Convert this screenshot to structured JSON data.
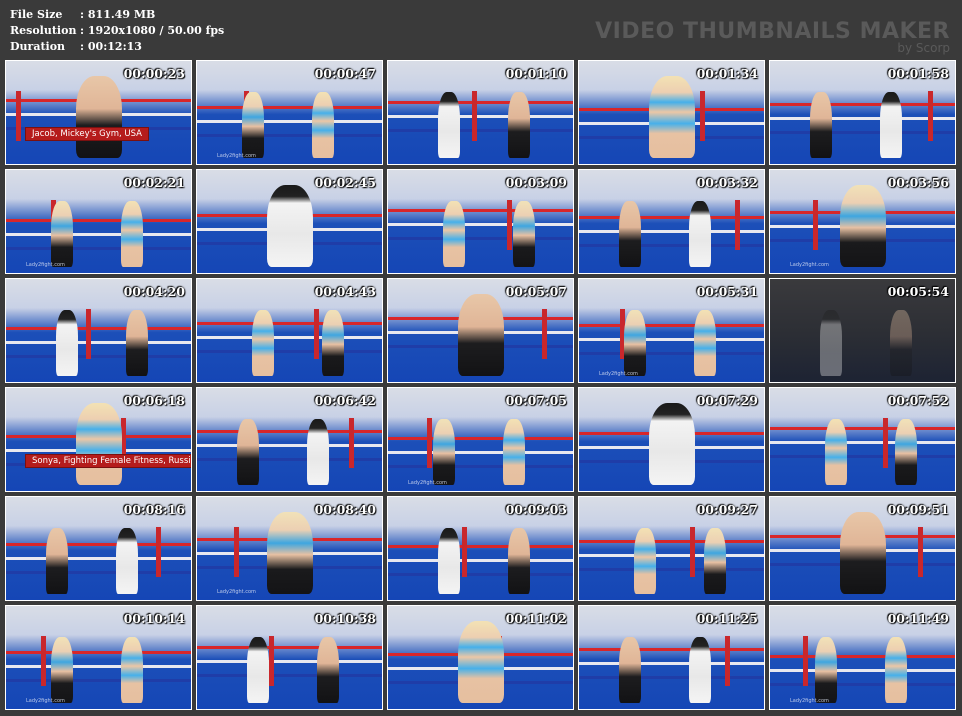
{
  "meta": {
    "file_size_label": "File Size",
    "file_size_value": ": 811.49 MB",
    "resolution_label": "Resolution",
    "resolution_value": ": 1920x1080 / 50.00 fps",
    "duration_label": "Duration",
    "duration_value": ": 00:12:13"
  },
  "watermark": {
    "title": "VIDEO THUMBNAILS MAKER",
    "subtitle": "by Scorp"
  },
  "thumbnails": [
    {
      "time": "00:00:23",
      "scene": "blue",
      "caption": "Jacob, Mickey's Gym, USA"
    },
    {
      "time": "00:00:47",
      "scene": "blue"
    },
    {
      "time": "00:01:10",
      "scene": "blue"
    },
    {
      "time": "00:01:34",
      "scene": "blue"
    },
    {
      "time": "00:01:58",
      "scene": "blue"
    },
    {
      "time": "00:02:21",
      "scene": "blue"
    },
    {
      "time": "00:02:45",
      "scene": "blue"
    },
    {
      "time": "00:03:09",
      "scene": "blue"
    },
    {
      "time": "00:03:32",
      "scene": "blue"
    },
    {
      "time": "00:03:56",
      "scene": "blue"
    },
    {
      "time": "00:04:20",
      "scene": "blue"
    },
    {
      "time": "00:04:43",
      "scene": "blue"
    },
    {
      "time": "00:05:07",
      "scene": "blue"
    },
    {
      "time": "00:05:31",
      "scene": "blue"
    },
    {
      "time": "00:05:54",
      "scene": "dark"
    },
    {
      "time": "00:06:18",
      "scene": "blue",
      "caption": "Sonya, Fighting Female Fitness, Russia"
    },
    {
      "time": "00:06:42",
      "scene": "blue"
    },
    {
      "time": "00:07:05",
      "scene": "blue"
    },
    {
      "time": "00:07:29",
      "scene": "blue"
    },
    {
      "time": "00:07:52",
      "scene": "blue"
    },
    {
      "time": "00:08:16",
      "scene": "blue"
    },
    {
      "time": "00:08:40",
      "scene": "blue"
    },
    {
      "time": "00:09:03",
      "scene": "blue"
    },
    {
      "time": "00:09:27",
      "scene": "blue"
    },
    {
      "time": "00:09:51",
      "scene": "blue"
    },
    {
      "time": "00:10:14",
      "scene": "blue"
    },
    {
      "time": "00:10:38",
      "scene": "blue"
    },
    {
      "time": "00:11:02",
      "scene": "blue"
    },
    {
      "time": "00:11:25",
      "scene": "blue"
    },
    {
      "time": "00:11:49",
      "scene": "blue"
    }
  ],
  "logo_text": "Lady2fight.com"
}
